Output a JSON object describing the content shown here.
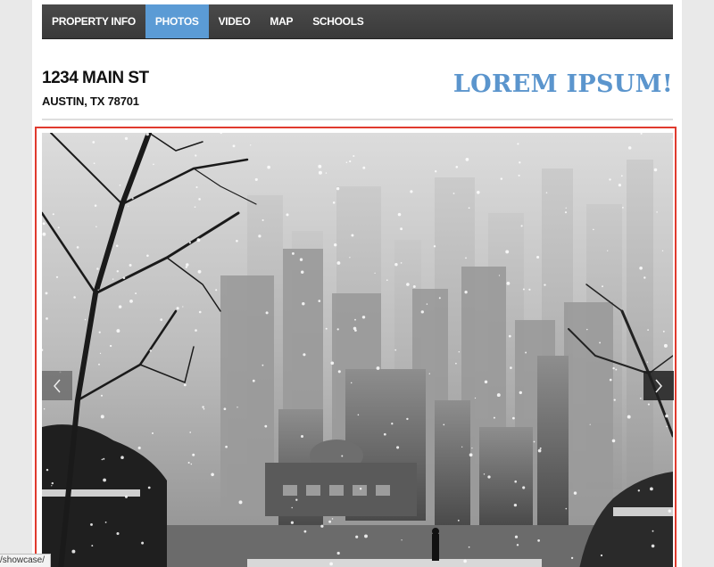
{
  "nav": {
    "items": [
      {
        "label": "PROPERTY INFO"
      },
      {
        "label": "PHOTOS"
      },
      {
        "label": "VIDEO"
      },
      {
        "label": "MAP"
      },
      {
        "label": "SCHOOLS"
      }
    ],
    "active": "PHOTOS"
  },
  "property": {
    "street": "1234 MAIN ST",
    "city_state_zip": "AUSTIN, TX 78701"
  },
  "brand": {
    "text": "LOREM IPSUM!",
    "color": "#5b95cd"
  },
  "gallery": {
    "prev_icon": "chevron-left-icon",
    "next_icon": "chevron-right-icon",
    "image_subject": "snowy futuristic city skyline photo"
  },
  "status_bar": {
    "url": "/showcase/"
  },
  "colors": {
    "nav_bg": "#3f3f3f",
    "nav_active": "#5b9bd5",
    "highlight_border": "#e03a2e"
  }
}
